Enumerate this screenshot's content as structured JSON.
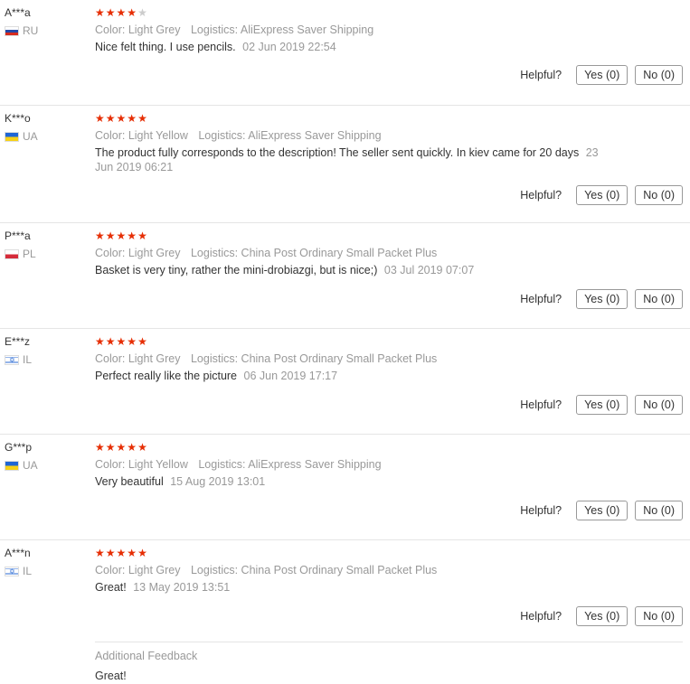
{
  "helpful_label": "Helpful?",
  "reviews": [
    {
      "user": "A***a",
      "country": "RU",
      "stars": 4,
      "color": "Color: Light Grey",
      "logistics": "Logistics: AliExpress Saver Shipping",
      "text": "Nice felt thing. I use pencils.",
      "date": "02 Jun 2019 22:54",
      "yes": "Yes (0)",
      "no": "No (0)"
    },
    {
      "user": "K***o",
      "country": "UA",
      "stars": 5,
      "color": "Color: Light Yellow",
      "logistics": "Logistics: AliExpress Saver Shipping",
      "text": "The product fully corresponds to the description! The seller sent quickly. In kiev came for 20 days",
      "date": "23 Jun 2019 06:21",
      "yes": "Yes (0)",
      "no": "No (0)"
    },
    {
      "user": "P***a",
      "country": "PL",
      "stars": 5,
      "color": "Color: Light Grey",
      "logistics": "Logistics: China Post Ordinary Small Packet Plus",
      "text": "Basket is very tiny, rather the mini-drobiazgi, but is nice;)",
      "date": "03 Jul 2019 07:07",
      "yes": "Yes (0)",
      "no": "No (0)"
    },
    {
      "user": "E***z",
      "country": "IL",
      "stars": 5,
      "color": "Color: Light Grey",
      "logistics": "Logistics: China Post Ordinary Small Packet Plus",
      "text": "Perfect really like the picture",
      "date": "06 Jun 2019 17:17",
      "yes": "Yes (0)",
      "no": "No (0)"
    },
    {
      "user": "G***p",
      "country": "UA",
      "stars": 5,
      "color": "Color: Light Yellow",
      "logistics": "Logistics: AliExpress Saver Shipping",
      "text": "Very beautiful",
      "date": "15 Aug 2019 13:01",
      "yes": "Yes (0)",
      "no": "No (0)"
    },
    {
      "user": "A***n",
      "country": "IL",
      "stars": 5,
      "color": "Color: Light Grey",
      "logistics": "Logistics: China Post Ordinary Small Packet Plus",
      "text": "Great!",
      "date": "13 May 2019 13:51",
      "yes": "Yes (0)",
      "no": "No (0)",
      "additional_title": "Additional Feedback",
      "additional_text": "Great!"
    }
  ]
}
